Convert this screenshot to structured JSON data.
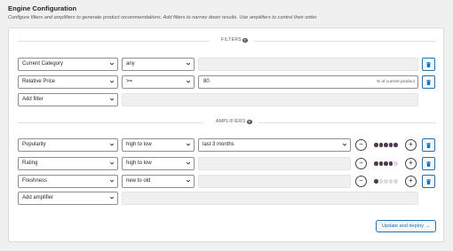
{
  "header": {
    "title": "Engine Configuration",
    "subtitle": "Configure filters and amplifiers to generate product recommendations. Add filters to narrow down results. Use amplifiers to control their order."
  },
  "filters": {
    "label": "FILTERS",
    "help_icon": "?",
    "rows": [
      {
        "field": "Current Category",
        "operator": "any",
        "value": "",
        "suffix": ""
      },
      {
        "field": "Relative Price",
        "operator": ">=",
        "value": "80",
        "suffix": "% of current product"
      }
    ],
    "add_label": "Add filter"
  },
  "amplifiers": {
    "label": "AMPLIFIERS",
    "help_icon": "?",
    "rows": [
      {
        "field": "Popularity",
        "order": "high to low",
        "period": "last 3 months",
        "weight": 5,
        "max_weight": 5
      },
      {
        "field": "Rating",
        "order": "high to low",
        "period": "",
        "weight": 4,
        "max_weight": 5
      },
      {
        "field": "Freshness",
        "order": "new to old",
        "period": "",
        "weight": 1,
        "max_weight": 5
      }
    ],
    "add_label": "Add amplifier",
    "minus": "−",
    "plus": "+"
  },
  "footer": {
    "deploy_label": "Update and deploy →"
  },
  "colors": {
    "accent": "#2271b1",
    "dot_on": "#4f3a50",
    "dot_off": "#dcdcde"
  },
  "icons": {
    "chevron": "chevron-down-icon",
    "help": "help-icon",
    "delete": "trash-icon"
  }
}
